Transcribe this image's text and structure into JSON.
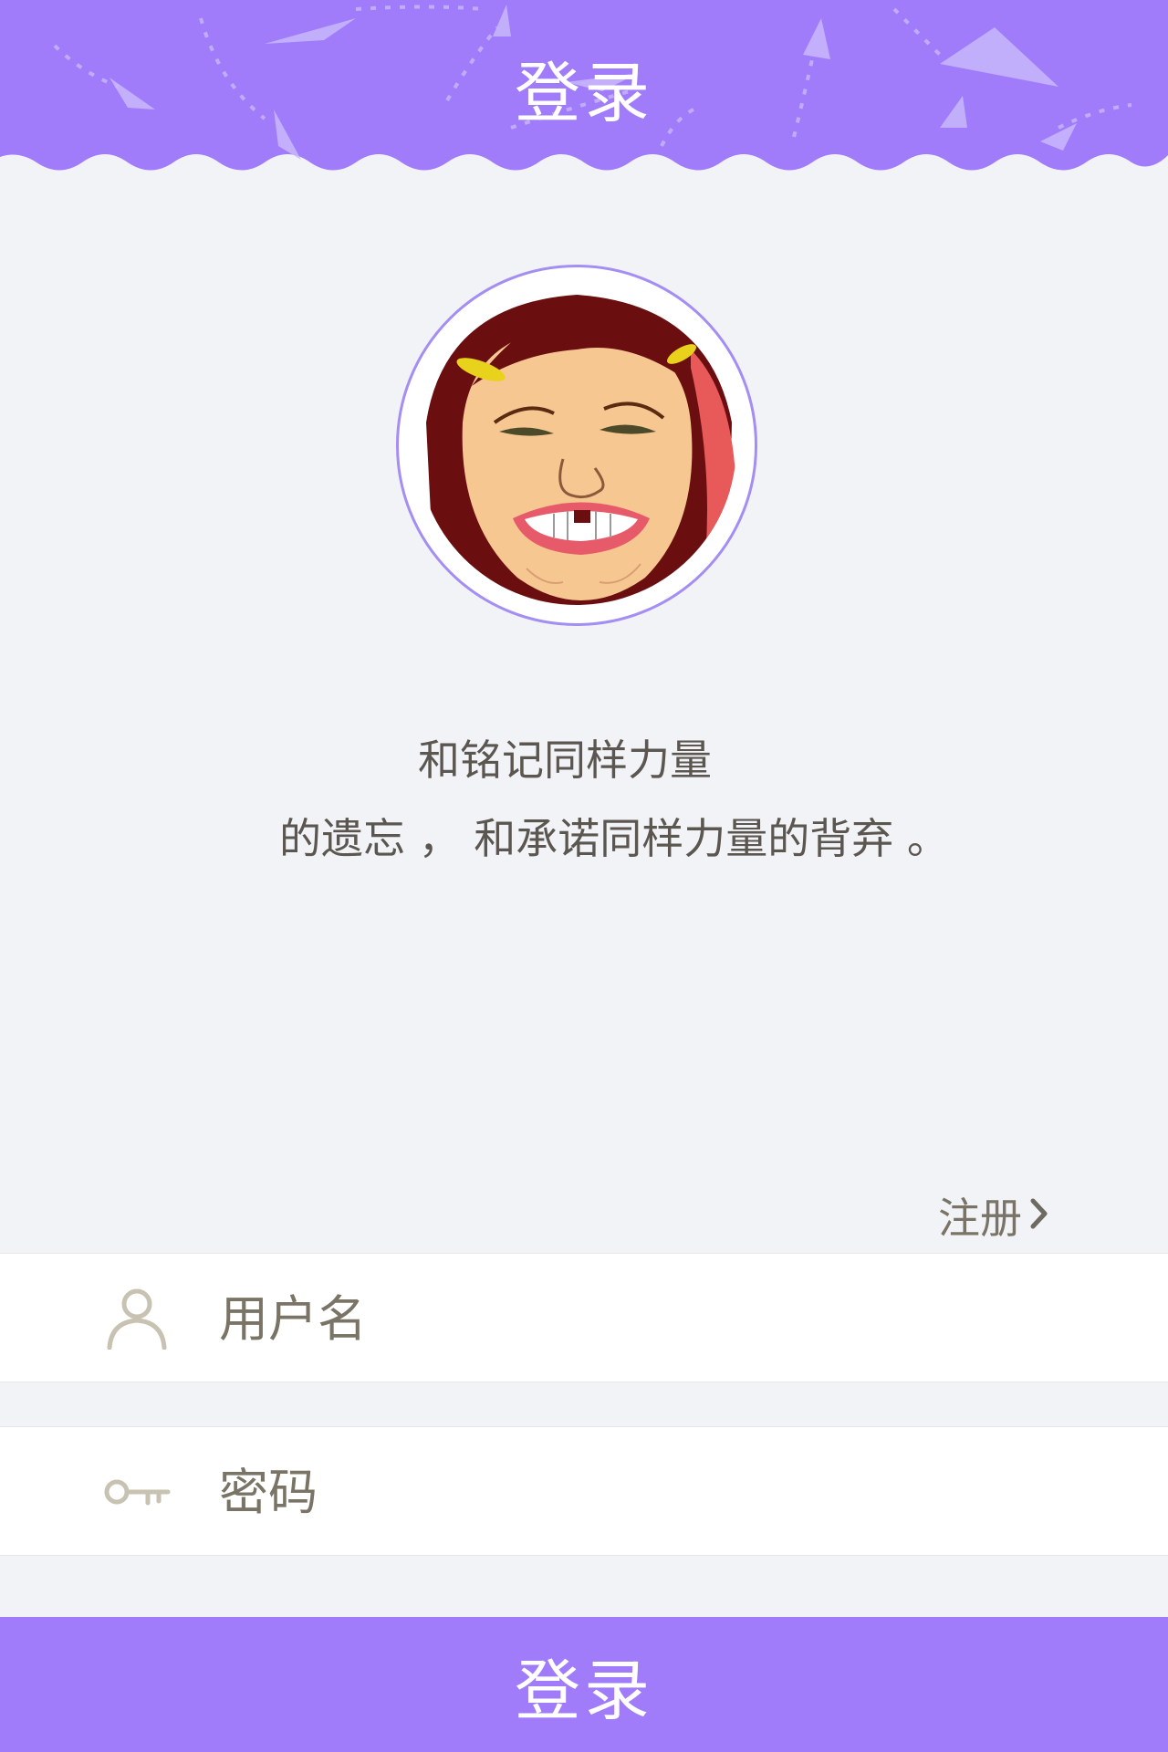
{
  "header": {
    "title": "登录"
  },
  "colors": {
    "primary": "#a07cfb",
    "background": "#f2f3f7",
    "text": "#5b5750",
    "icon": "#c7c2b2"
  },
  "profile": {
    "avatar_icon": "avatar-illustration"
  },
  "quote": {
    "line1": "和铭记同样力量",
    "line2": "的遗忘 ，  和承诺同样力量的背弃 。"
  },
  "register": {
    "label": "注册",
    "icon": "chevron-right-icon"
  },
  "form": {
    "username": {
      "placeholder": "用户名",
      "value": "",
      "icon": "user-icon"
    },
    "password": {
      "placeholder": "密码",
      "value": "",
      "icon": "key-icon"
    }
  },
  "login_button": {
    "label": "登录"
  }
}
